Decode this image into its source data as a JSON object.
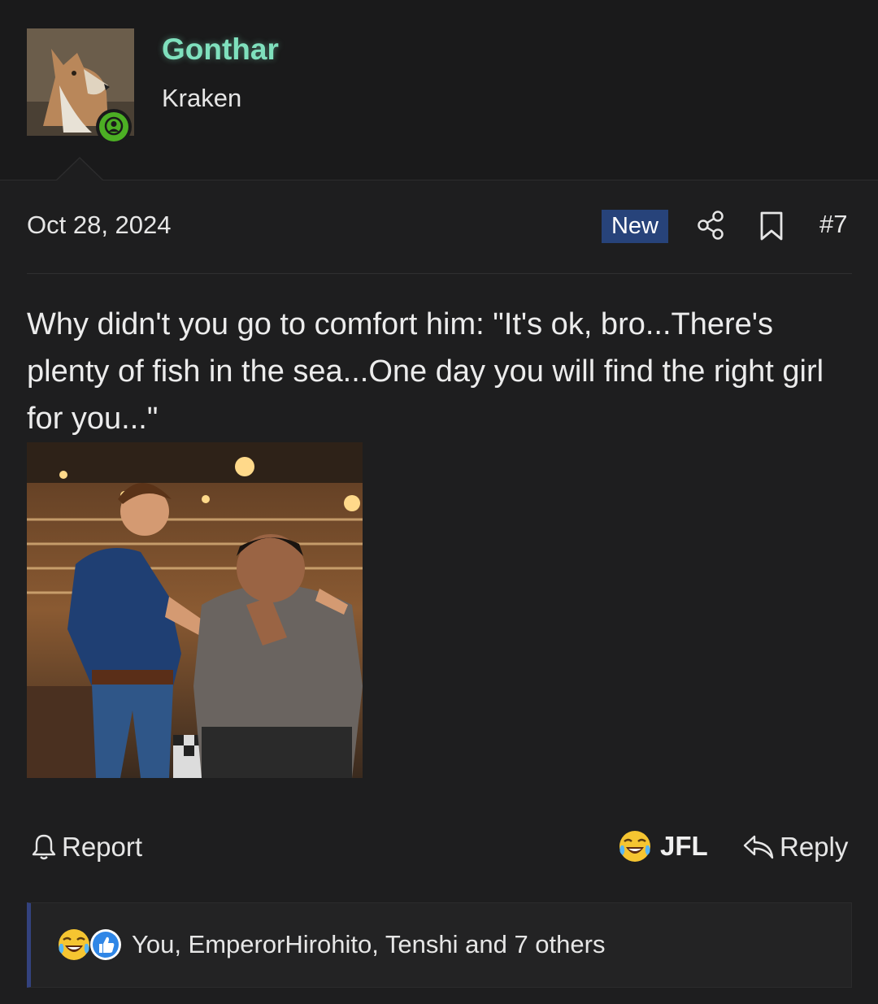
{
  "user": {
    "name": "Gonthar",
    "title": "Kraken",
    "avatar_icon": "wolf-avatar",
    "online_icon": "user-online-icon",
    "name_color": "#7fe0bd"
  },
  "post": {
    "date": "Oct 28, 2024",
    "new_label": "New",
    "number": "#7",
    "body": "Why didn't you go to comfort him: \"It's ok, bro...There's plenty of fish in the sea...One day you will find the right girl for you...\"",
    "image_icon": "restaurant-comfort-photo"
  },
  "actions": {
    "report_label": "Report",
    "jfl_label": "JFL",
    "reply_label": "Reply"
  },
  "reactions": {
    "summary": "You, EmperorHirohito, Tenshi and 7 others",
    "icons": [
      "laughing-crying-emoji",
      "thumbs-up-icon"
    ]
  },
  "colors": {
    "background": "#1e1e1f",
    "header_bg": "#1a1a1b",
    "new_badge": "#27437a",
    "online_green": "#4caf24",
    "reaction_border": "#33427e"
  }
}
